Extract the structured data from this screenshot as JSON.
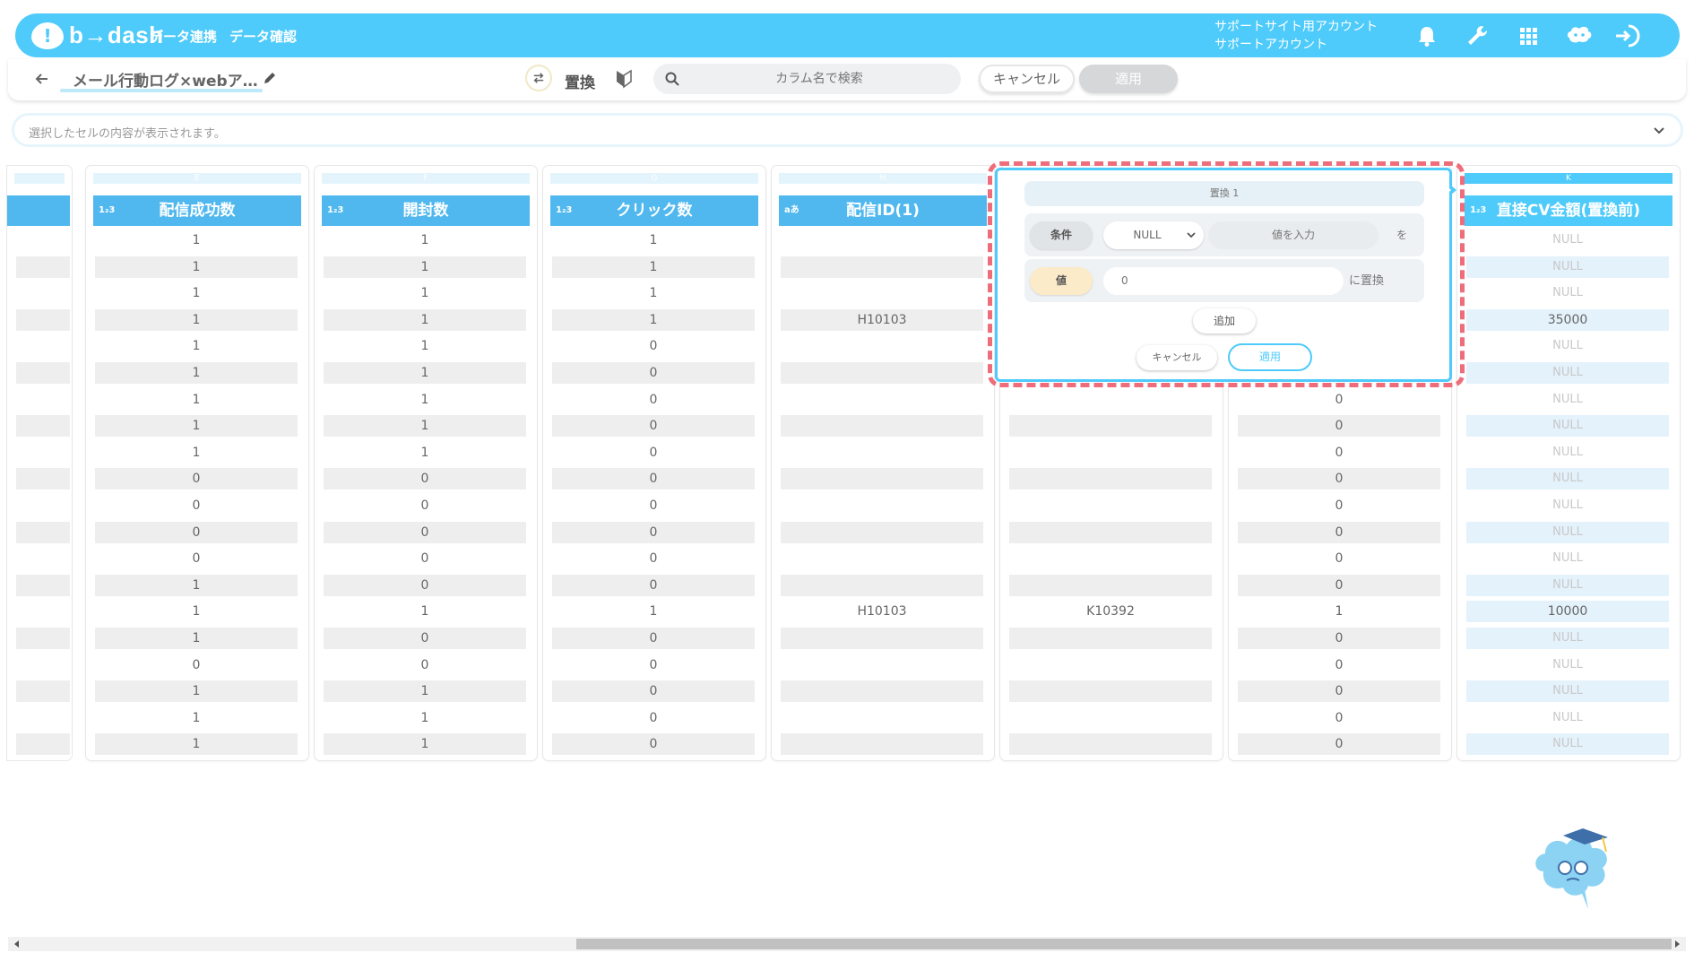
{
  "header": {
    "logo_text": "b→dash",
    "nav": [
      "データ連携",
      "データ確認"
    ],
    "account_line1": "サポートサイト用アカウント",
    "account_line2": "サポートアカウント",
    "icons": [
      "bell-icon",
      "wrench-icon",
      "grid-icon",
      "support-mascot-icon",
      "logout-icon"
    ],
    "accent_color": "#4ecbfa"
  },
  "toolbar": {
    "title": "メール行動ログ×webア…",
    "mode_label": "置換",
    "search_placeholder": "カラム名で検索",
    "cancel_label": "キャンセル",
    "apply_label": "適用"
  },
  "cellbar": {
    "placeholder": "選択したセルの内容が表示されます。"
  },
  "grid": {
    "columns": [
      {
        "letter": "E",
        "type": "1₂3",
        "name": "配信成功数"
      },
      {
        "letter": "F",
        "type": "1₂3",
        "name": "開封数"
      },
      {
        "letter": "G",
        "type": "1₂3",
        "name": "クリック数"
      },
      {
        "letter": "H",
        "type": "aあ",
        "name": "配信ID(1)"
      },
      {
        "letter": "K",
        "type": "1₂3",
        "name": "直接CV金額(置換前)"
      }
    ],
    "col_e": [
      "1",
      "1",
      "1",
      "1",
      "1",
      "1",
      "1",
      "1",
      "1",
      "0",
      "0",
      "0",
      "0",
      "1",
      "1",
      "1",
      "0",
      "1",
      "1",
      "1"
    ],
    "col_f": [
      "1",
      "1",
      "1",
      "1",
      "1",
      "1",
      "1",
      "1",
      "1",
      "0",
      "0",
      "0",
      "0",
      "0",
      "1",
      "0",
      "0",
      "1",
      "1",
      "1"
    ],
    "col_g": [
      "1",
      "1",
      "1",
      "1",
      "0",
      "0",
      "0",
      "0",
      "0",
      "0",
      "0",
      "0",
      "0",
      "0",
      "1",
      "0",
      "0",
      "0",
      "0",
      "0"
    ],
    "col_h": [
      "",
      "",
      "",
      "H10103",
      "",
      "",
      "",
      "",
      "",
      "",
      "",
      "",
      "",
      "",
      "H10103",
      "",
      "",
      "",
      "",
      ""
    ],
    "col_i": [
      "",
      "",
      "",
      "",
      "",
      "",
      "",
      "",
      "",
      "",
      "",
      "",
      "",
      "",
      "K10392",
      "",
      "",
      "",
      "",
      ""
    ],
    "col_j": [
      "",
      "",
      "",
      "",
      "",
      "",
      "0",
      "0",
      "0",
      "0",
      "0",
      "0",
      "0",
      "0",
      "1",
      "0",
      "0",
      "0",
      "0",
      "0"
    ],
    "col_k": [
      "NULL",
      "NULL",
      "NULL",
      "35000",
      "NULL",
      "NULL",
      "NULL",
      "NULL",
      "NULL",
      "NULL",
      "NULL",
      "NULL",
      "NULL",
      "NULL",
      "10000",
      "NULL",
      "NULL",
      "NULL",
      "NULL",
      "NULL"
    ]
  },
  "popup": {
    "title": "置換 1",
    "condition_label": "条件",
    "condition_value": "NULL",
    "value_placeholder": "値を入力",
    "wo": "を",
    "value_label": "値",
    "replace_value": "0",
    "replace_suffix": "に置換",
    "add_label": "追加",
    "cancel_label": "キャンセル",
    "apply_label": "適用",
    "highlight_color": "#ef6d7b"
  }
}
